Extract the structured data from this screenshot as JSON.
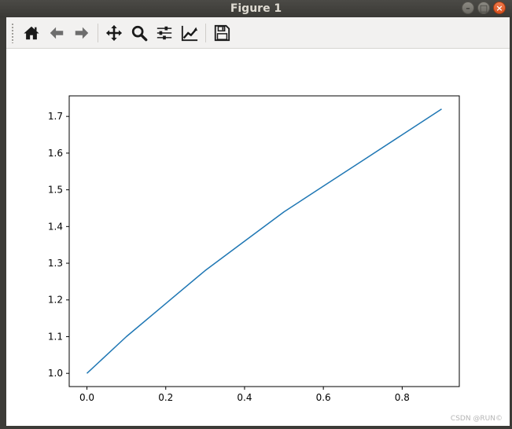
{
  "window": {
    "title": "Figure 1"
  },
  "controls": {
    "minimize_glyph": "–",
    "maximize_glyph": "□",
    "close_glyph": "×"
  },
  "toolbar": {
    "items": [
      {
        "name": "home-icon",
        "action": "home"
      },
      {
        "name": "back-arrow-icon",
        "action": "back"
      },
      {
        "name": "forward-arrow-icon",
        "action": "forward"
      },
      {
        "name": "pan-move-icon",
        "action": "pan"
      },
      {
        "name": "zoom-magnifier-icon",
        "action": "zoom"
      },
      {
        "name": "configure-subplots-icon",
        "action": "subplots"
      },
      {
        "name": "edit-axis-curves-icon",
        "action": "edit"
      },
      {
        "name": "save-floppy-icon",
        "action": "save"
      }
    ]
  },
  "watermark": "CSDN @RUN©",
  "chart_data": {
    "type": "line",
    "x": [
      0.0,
      0.1,
      0.2,
      0.3,
      0.4,
      0.5,
      0.6,
      0.7,
      0.8,
      0.9
    ],
    "series": [
      {
        "values": [
          1.0,
          1.1,
          1.19,
          1.28,
          1.36,
          1.44,
          1.51,
          1.58,
          1.65,
          1.72
        ],
        "color": "#1f77b4"
      }
    ],
    "xticks": [
      0.0,
      0.2,
      0.4,
      0.6,
      0.8
    ],
    "xtick_labels": [
      "0.0",
      "0.2",
      "0.4",
      "0.6",
      "0.8"
    ],
    "yticks": [
      1.0,
      1.1,
      1.2,
      1.3,
      1.4,
      1.5,
      1.6,
      1.7
    ],
    "ytick_labels": [
      "1.0",
      "1.1",
      "1.2",
      "1.3",
      "1.4",
      "1.5",
      "1.6",
      "1.7"
    ],
    "xlim": [
      -0.045,
      0.945
    ],
    "ylim": [
      0.964,
      1.756
    ],
    "grid": false
  }
}
